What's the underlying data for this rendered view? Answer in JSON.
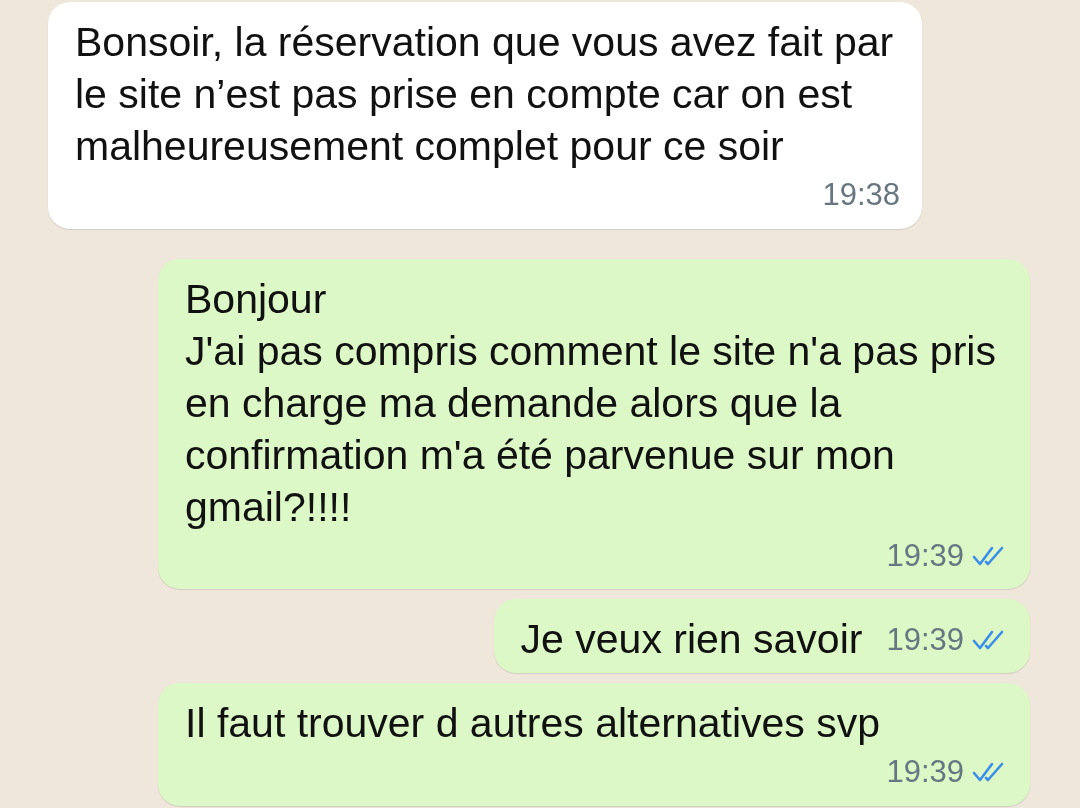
{
  "messages": [
    {
      "kind": "incoming",
      "text": "Bonsoir, la réservation que vous avez fait par le site n’est pas prise en compte car on est malheureusement complet pour ce soir",
      "time": "19:38"
    },
    {
      "kind": "outgoing",
      "text": "Bonjour\nJ'ai pas compris comment le site n'a pas pris en charge ma demande alors que la confirmation m'a été parvenue sur mon gmail?!!!!",
      "time": "19:39",
      "read": true
    },
    {
      "kind": "outgoing",
      "text": "Je veux rien savoir",
      "time": "19:39",
      "read": true
    },
    {
      "kind": "outgoing",
      "text": "Il faut trouver d autres alternatives svp",
      "time": "19:39",
      "read": true
    }
  ]
}
